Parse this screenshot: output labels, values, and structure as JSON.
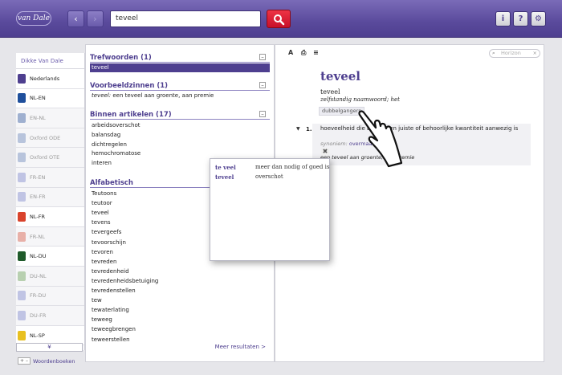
{
  "header": {
    "logo": "van Dale",
    "back": "‹",
    "forward": "›",
    "search_value": "teveel",
    "info": "i",
    "help": "?",
    "settings": "⚙"
  },
  "sidebar": {
    "header": "Dikke Van Dale",
    "items": [
      {
        "label": "Nederlands",
        "color": "#4e3f8f",
        "active": true
      },
      {
        "label": "NL-EN",
        "color": "#1f4f9c",
        "active": true
      },
      {
        "label": "EN-NL",
        "color": "#9fb0d0",
        "active": false
      },
      {
        "label": "Oxford ODE",
        "color": "#b8c4dc",
        "active": false
      },
      {
        "label": "Oxford OTE",
        "color": "#b8c4dc",
        "active": false
      },
      {
        "label": "FR-EN",
        "color": "#c0c4e4",
        "active": false
      },
      {
        "label": "EN-FR",
        "color": "#c0c4e4",
        "active": false
      },
      {
        "label": "NL-FR",
        "color": "#d9432c",
        "active": true
      },
      {
        "label": "FR-NL",
        "color": "#e8b0a8",
        "active": false
      },
      {
        "label": "NL-DU",
        "color": "#1f5a2a",
        "active": true
      },
      {
        "label": "DU-NL",
        "color": "#b8d0b0",
        "active": false
      },
      {
        "label": "FR-DU",
        "color": "#c0c4e4",
        "active": false
      },
      {
        "label": "DU-FR",
        "color": "#c0c4e4",
        "active": false
      },
      {
        "label": "NL-SP",
        "color": "#e8c020",
        "active": true
      }
    ],
    "scroll_label": "¥",
    "footer_pm": "+ –",
    "footer_label": "Woordenboeken"
  },
  "results": {
    "sections": {
      "trefwoorden": {
        "title": "Trefwoorden (1)",
        "items": [
          "teveel"
        ]
      },
      "voorbeeldzinnen": {
        "title": "Voorbeeldzinnen (1)",
        "italic": "teveel:",
        "rest": " een teveel aan groente, aan premie"
      },
      "binnen": {
        "title": "Binnen artikelen (17)",
        "items": [
          "arbeidsoverschot",
          "balansdag",
          "dichtregelen",
          "hemochromatose",
          "interen"
        ]
      },
      "alfabetisch": {
        "title": "Alfabetisch",
        "items": [
          "Teutoons",
          "teutoor",
          "teveel",
          "tevens",
          "tevergeefs",
          "tevoorschijn",
          "tevoren",
          "tevreden",
          "tevredenheid",
          "tevredenheidsbetuiging",
          "tevredenstellen",
          "tew",
          "tewaterlating",
          "teweeg",
          "teweegbrengen",
          "teweerstellen"
        ]
      }
    },
    "collapse": "–",
    "more": "Meer resultaten >"
  },
  "entry": {
    "tools": {
      "font": "A",
      "print": "⎙",
      "list": "≡"
    },
    "lookup_placeholder": "Horizon",
    "headword": "teveel",
    "lemma": "teveel",
    "grammar": "zelfstandig naamwoord; het",
    "tag": "dubbelgangers",
    "meaning": {
      "number": "1.",
      "text": "hoeveelheid die boven een juiste of behoorlijke kwantiteit aanwezig is",
      "syn_label": "synoniem:",
      "syn": "overmaat",
      "example": "een teveel aan groente, aan premie"
    }
  },
  "popup": {
    "close": "✖",
    "rows": [
      {
        "k": "te veel",
        "v": "meer dan nodig of goed is"
      },
      {
        "k": "teveel",
        "v": "overschot"
      }
    ]
  }
}
